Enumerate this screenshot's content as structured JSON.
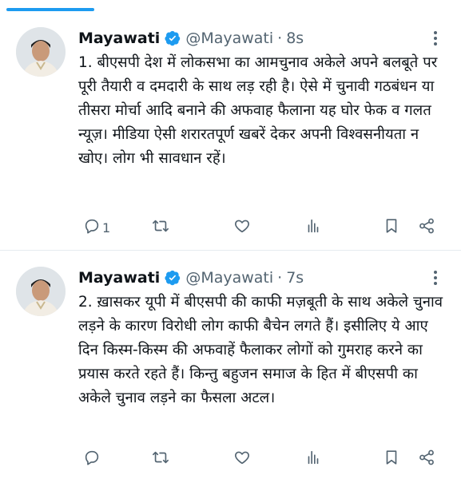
{
  "colors": {
    "accent": "#1d9bf0",
    "text": "#0f1419",
    "secondary": "#536471"
  },
  "icons": {
    "reply": "reply-icon",
    "retweet": "retweet-icon",
    "like": "heart-icon",
    "views": "views-icon",
    "bookmark": "bookmark-icon",
    "share": "share-icon",
    "verified": "verified-badge-icon",
    "more": "more-icon"
  },
  "tweets": [
    {
      "name": "Mayawati",
      "handle": "@Mayawati",
      "separator": "·",
      "time": "8s",
      "text": "1. बीएसपी देश में लोकसभा का आमचुनाव अकेले अपने बलबूते पर पूरी तैयारी व दमदारी के साथ लड़ रही है। ऐसे में चुनावी गठबंधन या तीसरा मोर्चा आदि बनाने की अफवाह फैलाना यह घोर फेक व गलत न्यूज़। मीडिया ऐसी शरारतपूर्ण खबरें देकर अपनी विश्वसनीयता न खोए। लोग भी सावधान रहें।",
      "reply_count": "1"
    },
    {
      "name": "Mayawati",
      "handle": "@Mayawati",
      "separator": "·",
      "time": "7s",
      "text": "2. ख़ासकर यूपी में बीएसपी की काफी मज़बूती के साथ अकेले चुनाव लड़ने के कारण विरोधी लोग काफी बैचेन लगते हैं। इसीलिए ये आए दिन किस्म-किस्म की अफवाहें फैलाकर लोगों को गुमराह करने का प्रयास करते रहते हैं। किन्तु बहुजन समाज के हित में बीएसपी का अकेले चुनाव लड़ने का फैसला अटल।",
      "reply_count": ""
    }
  ]
}
